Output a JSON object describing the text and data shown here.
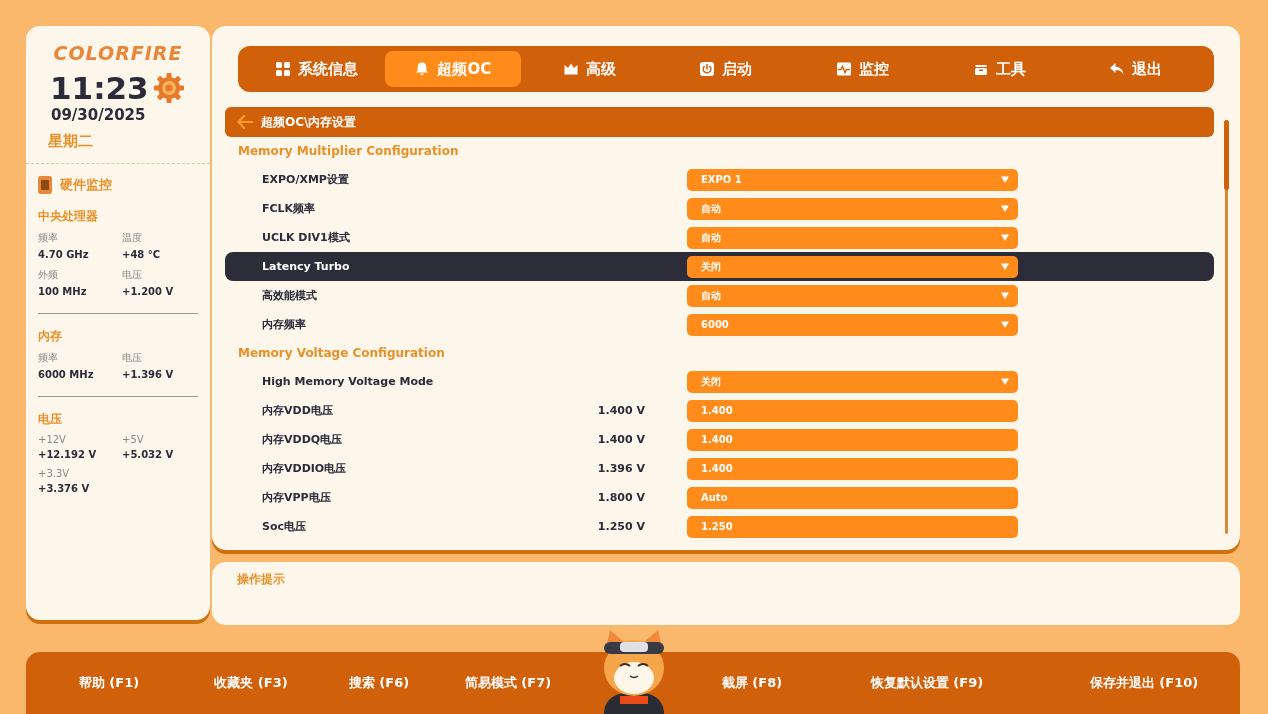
{
  "sidebar": {
    "logo": "COLORFIRE",
    "time": "11:23",
    "date": "09/30/2025",
    "weekday": "星期二",
    "monitor_title": "硬件监控",
    "groups": [
      {
        "title": "中央处理器",
        "items": [
          {
            "label": "频率",
            "value": "4.70 GHz"
          },
          {
            "label": "温度",
            "value": "+48 °C"
          },
          {
            "label": "外频",
            "value": "100 MHz"
          },
          {
            "label": "电压",
            "value": "+1.200 V"
          }
        ]
      },
      {
        "title": "内存",
        "items": [
          {
            "label": "频率",
            "value": "6000 MHz"
          },
          {
            "label": "电压",
            "value": "+1.396 V"
          }
        ]
      },
      {
        "title": "电压",
        "items": [
          {
            "label": "+12V",
            "value": "+12.192 V"
          },
          {
            "label": "+5V",
            "value": "+5.032 V"
          },
          {
            "label": "+3.3V",
            "value": "+3.376 V"
          }
        ]
      }
    ]
  },
  "tabs": [
    {
      "label": "系统信息",
      "selected": false
    },
    {
      "label": "超频OC",
      "selected": true
    },
    {
      "label": "高级",
      "selected": false
    },
    {
      "label": "启动",
      "selected": false
    },
    {
      "label": "监控",
      "selected": false
    },
    {
      "label": "工具",
      "selected": false
    },
    {
      "label": "退出",
      "selected": false
    }
  ],
  "breadcrumb": "超频OC\\内存设置",
  "sections": [
    {
      "title": "Memory Multiplier Configuration",
      "rows": [
        {
          "label": "EXPO/XMP设置",
          "kind": "select",
          "value": "EXPO 1",
          "selected": false
        },
        {
          "label": "FCLK频率",
          "kind": "select",
          "value": "自动",
          "selected": false
        },
        {
          "label": "UCLK DIV1模式",
          "kind": "select",
          "value": "自动",
          "selected": false
        },
        {
          "label": "Latency Turbo",
          "kind": "select",
          "value": "关闭",
          "selected": true
        },
        {
          "label": "高效能模式",
          "kind": "select",
          "value": "自动",
          "selected": false
        },
        {
          "label": "内存频率",
          "kind": "select",
          "value": "6000",
          "selected": false
        }
      ]
    },
    {
      "title": "Memory Voltage Configuration",
      "rows": [
        {
          "label": "High Memory Voltage Mode",
          "kind": "select",
          "value": "关闭",
          "selected": false
        },
        {
          "label": "内存VDD电压",
          "kind": "input",
          "reading": "1.400 V",
          "value": "1.400",
          "selected": false
        },
        {
          "label": "内存VDDQ电压",
          "kind": "input",
          "reading": "1.400 V",
          "value": "1.400",
          "selected": false
        },
        {
          "label": "内存VDDIO电压",
          "kind": "input",
          "reading": "1.396 V",
          "value": "1.400",
          "selected": false
        },
        {
          "label": "内存VPP电压",
          "kind": "input",
          "reading": "1.800 V",
          "value": "Auto",
          "selected": false
        },
        {
          "label": "Soc电压",
          "kind": "input",
          "reading": "1.250 V",
          "value": "1.250",
          "selected": false
        }
      ]
    }
  ],
  "hint": {
    "title": "操作提示"
  },
  "footer": [
    {
      "label": "帮助 (F1)"
    },
    {
      "label": "收藏夹 (F3)"
    },
    {
      "label": "搜索 (F6)"
    },
    {
      "label": "简易模式 (F7)"
    },
    {
      "label": "截屏 (F8)"
    },
    {
      "label": "恢复默认设置 (F9)"
    },
    {
      "label": "保存并退出 (F10)"
    }
  ]
}
